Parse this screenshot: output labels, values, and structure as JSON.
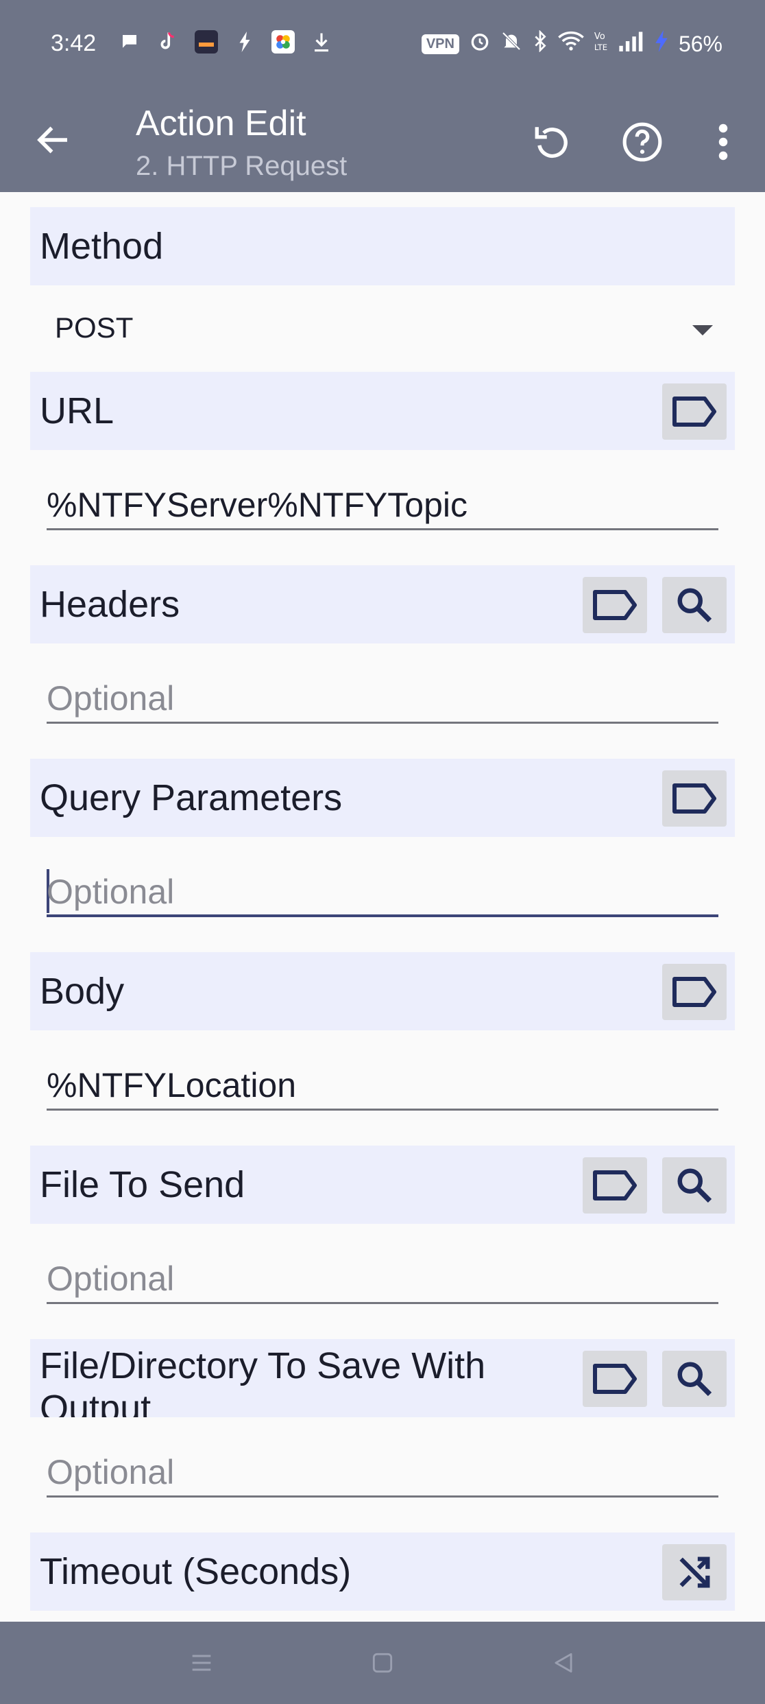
{
  "status_bar": {
    "time": "3:42",
    "vpn_label": "VPN",
    "battery": "56%",
    "notification_icons": [
      "chat-icon",
      "tiktok-icon",
      "discover-icon",
      "bolt-icon",
      "photos-icon",
      "download-icon"
    ],
    "system_icons": [
      "alarm-icon",
      "mute-icon",
      "bluetooth-icon",
      "wifi-icon",
      "volte-icon",
      "signal-icon",
      "charging-icon"
    ]
  },
  "app_bar": {
    "title": "Action Edit",
    "subtitle": "2. HTTP Request",
    "actions": [
      "undo-icon",
      "help-icon",
      "more-icon"
    ]
  },
  "form": {
    "method": {
      "label": "Method",
      "value": "POST"
    },
    "url": {
      "label": "URL",
      "value": "%NTFYServer%NTFYTopic"
    },
    "headers": {
      "label": "Headers",
      "placeholder": "Optional"
    },
    "query_parameters": {
      "label": "Query Parameters",
      "placeholder": "Optional"
    },
    "body": {
      "label": "Body",
      "value": "%NTFYLocation"
    },
    "file_to_send": {
      "label": "File To Send",
      "placeholder": "Optional"
    },
    "file_save": {
      "label": "File/Directory To Save With Output",
      "placeholder": "Optional"
    },
    "timeout": {
      "label": "Timeout (Seconds)"
    }
  },
  "colors": {
    "app_bar": "#6e7487",
    "section_bg": "#eceefc",
    "button_bg": "#d9dade",
    "icon_color": "#1f2b5b",
    "focus_line": "#3c4578"
  }
}
